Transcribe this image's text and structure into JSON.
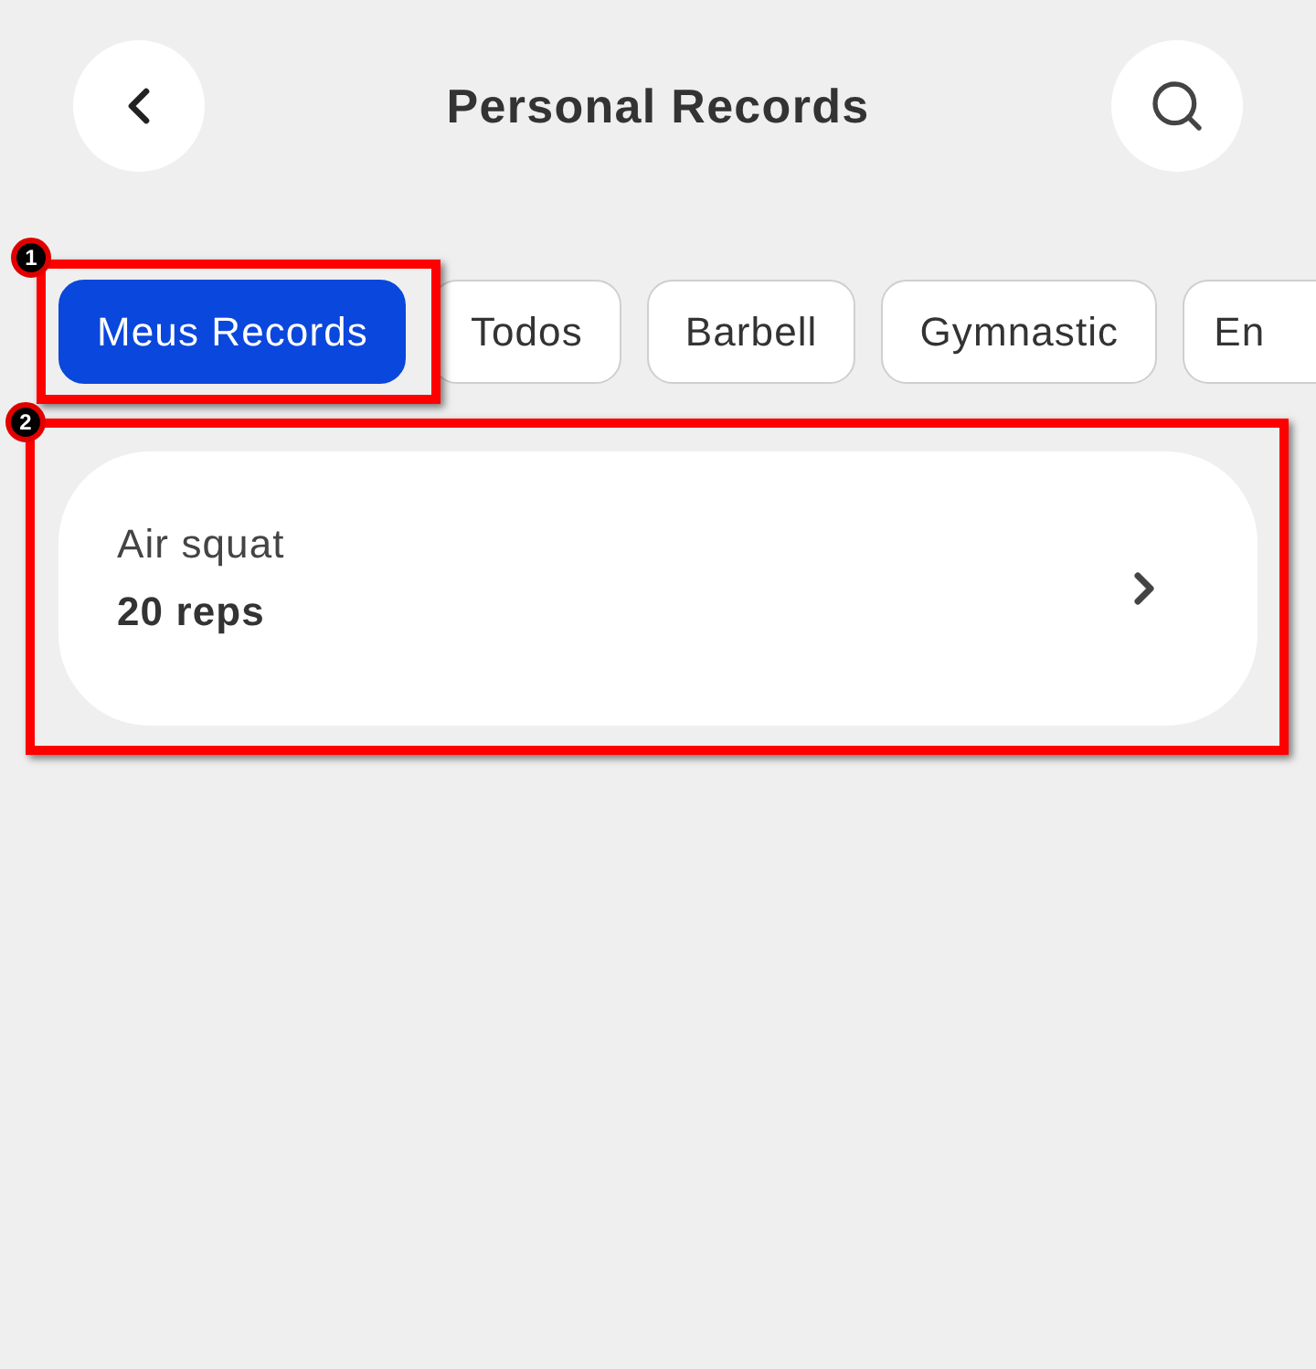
{
  "header": {
    "title": "Personal Records"
  },
  "filters": [
    {
      "label": "Meus Records",
      "selected": true,
      "cut": false
    },
    {
      "label": "Todos",
      "selected": false,
      "cut": false
    },
    {
      "label": "Barbell",
      "selected": false,
      "cut": false
    },
    {
      "label": "Gymnastic",
      "selected": false,
      "cut": false
    },
    {
      "label": "En",
      "selected": false,
      "cut": true
    }
  ],
  "records": [
    {
      "name": "Air squat",
      "value": "20 reps"
    }
  ],
  "annotations": [
    {
      "number": "1"
    },
    {
      "number": "2"
    }
  ]
}
